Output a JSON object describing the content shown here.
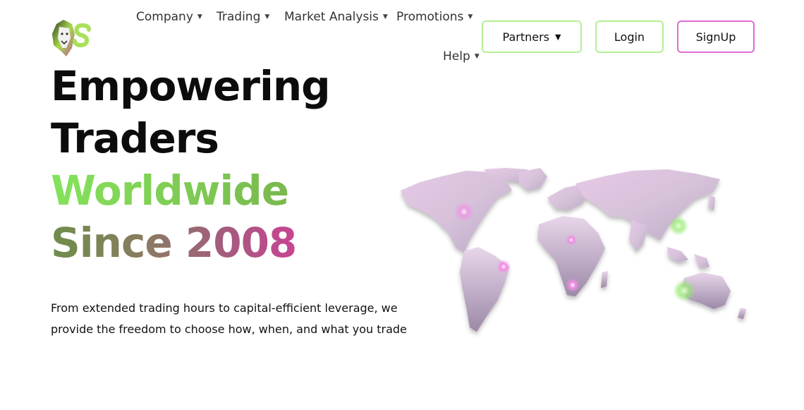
{
  "nav": {
    "items": [
      {
        "label": "Company"
      },
      {
        "label": "Trading"
      },
      {
        "label": "Market Analysis"
      },
      {
        "label": "Promotions"
      },
      {
        "label": "Help"
      }
    ]
  },
  "actions": {
    "partners_label": "Partners",
    "partners_caret": "▼",
    "login_label": "Login",
    "signup_label": "SignUp"
  },
  "hero": {
    "line1": "Empowering",
    "line2": "Traders",
    "line3": "Worldwide",
    "line4": "Since 2008",
    "description": "From extended trading hours to capital-efficient leverage, we provide the freedom to choose how, when, and what you trade"
  },
  "colors": {
    "accent_green": "#84e35b",
    "accent_pink": "#c84492",
    "button_green_border": "#b4ef94",
    "button_pink_border": "#e06ad6"
  },
  "icons": {
    "logo": "lion-logo-icon",
    "dropdown": "caret-down-icon",
    "map": "world-map-icon"
  }
}
